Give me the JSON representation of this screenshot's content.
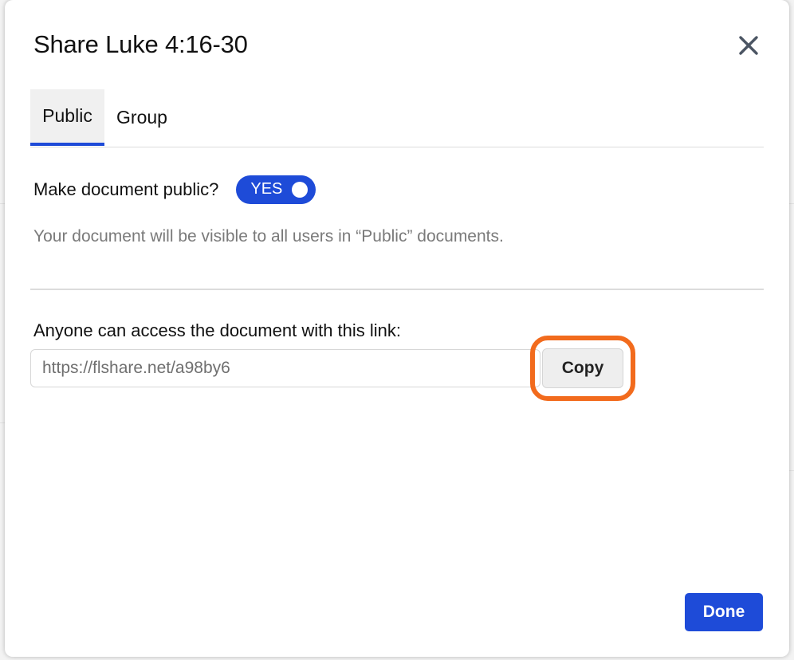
{
  "dialog": {
    "title": "Share Luke 4:16-30",
    "close_icon": "close-icon"
  },
  "tabs": [
    {
      "label": "Public",
      "active": true
    },
    {
      "label": "Group",
      "active": false
    }
  ],
  "public_toggle": {
    "label": "Make document public?",
    "state_text": "YES",
    "on": true,
    "hint": "Your document will be visible to all users in “Public” documents."
  },
  "link": {
    "label": "Anyone can access the document with this link:",
    "url": "https://flshare.net/a98by6",
    "copy_label": "Copy"
  },
  "footer": {
    "done_label": "Done"
  },
  "colors": {
    "accent": "#1e4bd8",
    "highlight": "#f26b1d"
  }
}
